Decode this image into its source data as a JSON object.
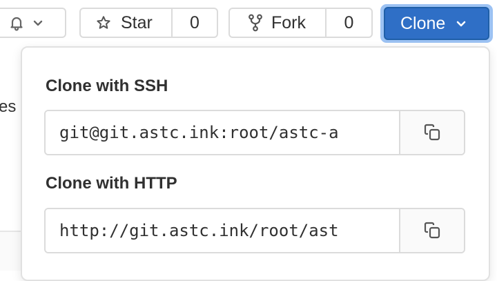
{
  "background": {
    "partial_text": "es"
  },
  "toolbar": {
    "notification": {
      "icon": "bell-icon",
      "chevron": "chevron-down-icon"
    },
    "star": {
      "icon": "star-icon",
      "label": "Star",
      "count": "0"
    },
    "fork": {
      "icon": "fork-icon",
      "label": "Fork",
      "count": "0"
    },
    "clone": {
      "label": "Clone",
      "chevron": "chevron-down-icon",
      "color": "#2f6fc6"
    }
  },
  "clone_dropdown": {
    "ssh": {
      "label": "Clone with SSH",
      "value": "git@git.astc.ink:root/astc-a",
      "copy_icon": "copy-icon"
    },
    "http": {
      "label": "Clone with HTTP",
      "value": "http://git.astc.ink/root/ast",
      "copy_icon": "copy-icon"
    }
  }
}
